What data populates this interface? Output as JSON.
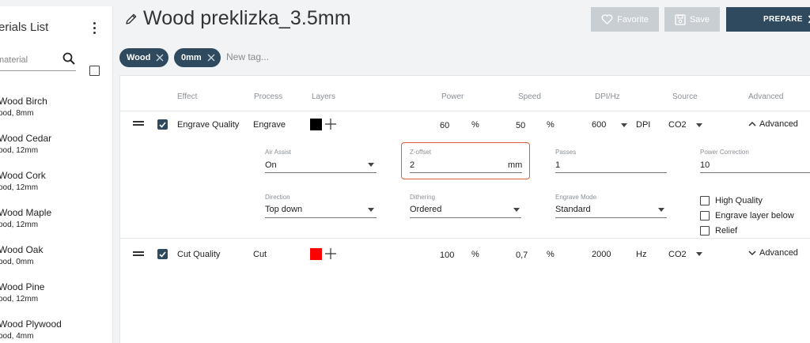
{
  "sidebar": {
    "title": "erials List",
    "search_placeholder": "material",
    "items": [
      {
        "name": "Wood Birch",
        "sub": "ood, 8mm"
      },
      {
        "name": "Wood Cedar",
        "sub": "ood, 12mm"
      },
      {
        "name": "Wood Cork",
        "sub": "ood, 12mm"
      },
      {
        "name": "Wood Maple",
        "sub": "ood, 12mm"
      },
      {
        "name": "Wood Oak",
        "sub": "ood, 0mm"
      },
      {
        "name": "Wood Pine",
        "sub": "ood, 12mm"
      },
      {
        "name": "Wood Plywood",
        "sub": "ood, 4mm"
      }
    ]
  },
  "header": {
    "title": "Wood preklizka_3.5mm",
    "favorite_label": "Favorite",
    "save_label": "Save",
    "prepare_label": "PREPARE"
  },
  "tags": {
    "items": [
      "Wood",
      "0mm"
    ],
    "new_placeholder": "New tag..."
  },
  "columns": {
    "effect": "Effect",
    "process": "Process",
    "layers": "Layers",
    "power": "Power",
    "speed": "Speed",
    "dpi_hz": "DPI/Hz",
    "source": "Source",
    "advanced": "Advanced"
  },
  "rows": [
    {
      "effect": "Engrave Quality",
      "process": "Engrave",
      "layer_color": "#000000",
      "power": "60",
      "power_unit": "%",
      "speed": "50",
      "speed_unit": "%",
      "dpi": "600",
      "dpi_unit": "DPI",
      "source": "CO2",
      "advanced": "Advanced"
    },
    {
      "effect": "Cut Quality",
      "process": "Cut",
      "layer_color": "#ff0000",
      "power": "100",
      "power_unit": "%",
      "speed": "0,7",
      "speed_unit": "%",
      "dpi": "2000",
      "dpi_unit": "Hz",
      "source": "CO2",
      "advanced": "Advanced"
    }
  ],
  "advanced": {
    "air_assist": {
      "label": "Air Assist",
      "value": "On"
    },
    "z_offset": {
      "label": "Z-offset",
      "value": "2",
      "unit": "mm"
    },
    "passes": {
      "label": "Passes",
      "value": "1"
    },
    "power_correction": {
      "label": "Power Correction",
      "value": "10"
    },
    "direction": {
      "label": "Direction",
      "value": "Top down"
    },
    "dithering": {
      "label": "Dithering",
      "value": "Ordered"
    },
    "engrave_mode": {
      "label": "Engrave Mode",
      "value": "Standard"
    },
    "checkboxes": [
      "High Quality",
      "Engrave layer below",
      "Relief"
    ]
  },
  "colors": {
    "accent": "#2f4a5e",
    "highlight": "#d9603e",
    "disabled": "#c9ced3"
  }
}
